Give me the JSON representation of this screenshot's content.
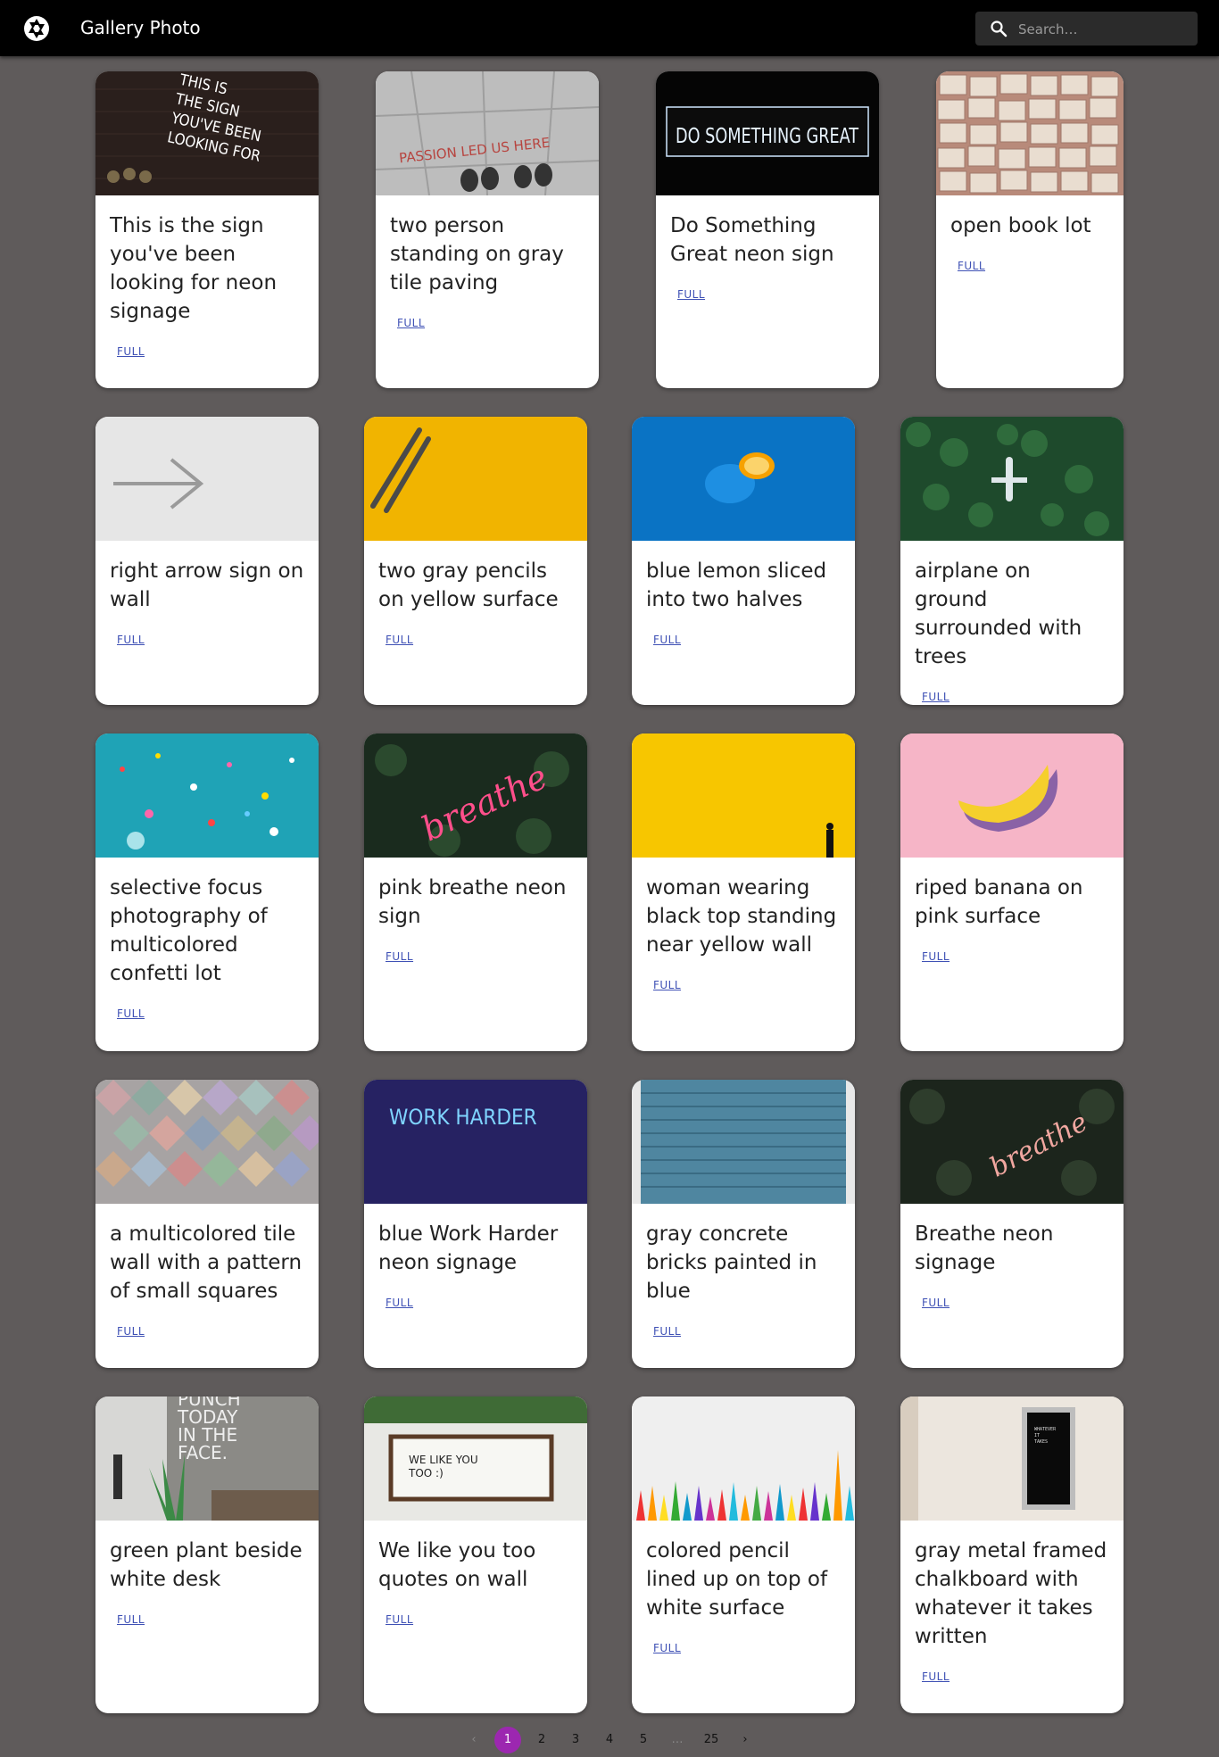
{
  "app": {
    "title": "Gallery Photo",
    "search_placeholder": "Search…"
  },
  "cards": [
    {
      "title": "This is the sign you've been looking for neon signage",
      "link": "FULL"
    },
    {
      "title": "two person standing on gray tile paving",
      "link": "FULL"
    },
    {
      "title": "Do Something Great neon sign",
      "link": "FULL"
    },
    {
      "title": "open book lot",
      "link": "FULL"
    },
    {
      "title": "right arrow sign on wall",
      "link": "FULL"
    },
    {
      "title": "two gray pencils on yellow surface",
      "link": "FULL"
    },
    {
      "title": "blue lemon sliced into two halves",
      "link": "FULL"
    },
    {
      "title": "airplane on ground surrounded with trees",
      "link": "FULL"
    },
    {
      "title": "selective focus photography of multicolored confetti lot",
      "link": "FULL"
    },
    {
      "title": "pink breathe neon sign",
      "link": "FULL"
    },
    {
      "title": "woman wearing black top standing near yellow wall",
      "link": "FULL"
    },
    {
      "title": "riped banana on pink surface",
      "link": "FULL"
    },
    {
      "title": "a multicolored tile wall with a pattern of small squares",
      "link": "FULL"
    },
    {
      "title": "blue Work Harder neon signage",
      "link": "FULL"
    },
    {
      "title": "gray concrete bricks painted in blue",
      "link": "FULL"
    },
    {
      "title": "Breathe neon signage",
      "link": "FULL"
    },
    {
      "title": "green plant beside white desk",
      "link": "FULL"
    },
    {
      "title": "We like you too quotes on wall",
      "link": "FULL"
    },
    {
      "title": "colored pencil lined up on top of white surface",
      "link": "FULL"
    },
    {
      "title": "gray metal framed chalkboard with whatever it takes written",
      "link": "FULL"
    }
  ],
  "image_text": {
    "neon_sign": [
      "THIS IS",
      "THE SIGN",
      "YOU'VE BEEN",
      "LOOKING FOR"
    ],
    "paving": "PASSION LED US HERE",
    "do_something": "DO SOMETHING GREAT",
    "breathe": "breathe",
    "work_harder": "WORK HARDER",
    "punch": [
      "PUNCH",
      "TODAY",
      "IN THE",
      "FACE."
    ],
    "we_like": [
      "WE LIKE YOU",
      "TOO :)"
    ],
    "whatever": [
      "WHATEVER",
      "IT",
      "TAKES"
    ]
  },
  "pagination": {
    "prev": "‹",
    "pages": [
      "1",
      "2",
      "3",
      "4",
      "5"
    ],
    "ellipsis": "…",
    "last": "25",
    "next": "›",
    "current": "1"
  },
  "colors": {
    "background": "#5f5b5b",
    "appbar": "#000000",
    "link": "#3f51b5",
    "active_page": "#9c27b0"
  }
}
